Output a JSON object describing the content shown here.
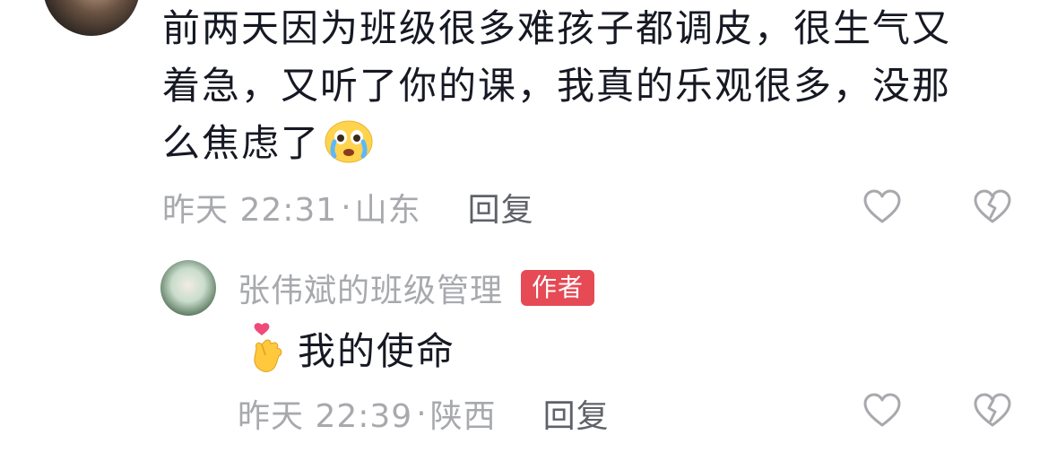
{
  "comment": {
    "text": "前两天因为班级很多难孩子都调皮，很生气又着急，又听了你的课，我真的乐观很多，没那么焦虑了",
    "emoji": "crying-face-emoji",
    "time": "昨天 22:31",
    "separator": "·",
    "location": "山东",
    "reply_label": "回复"
  },
  "reply": {
    "author": "张伟斌的班级管理",
    "badge": "作者",
    "emoji": "finger-heart-emoji",
    "text": "我的使命",
    "time": "昨天 22:39",
    "separator": "·",
    "location": "陕西",
    "reply_label": "回复"
  },
  "icons": {
    "like": "heart-outline-icon",
    "dislike": "broken-heart-icon"
  },
  "colors": {
    "primary_text": "#161823",
    "secondary_text": "#a7a9ad",
    "reply_link": "#5f6268",
    "badge": "#e54a55"
  }
}
